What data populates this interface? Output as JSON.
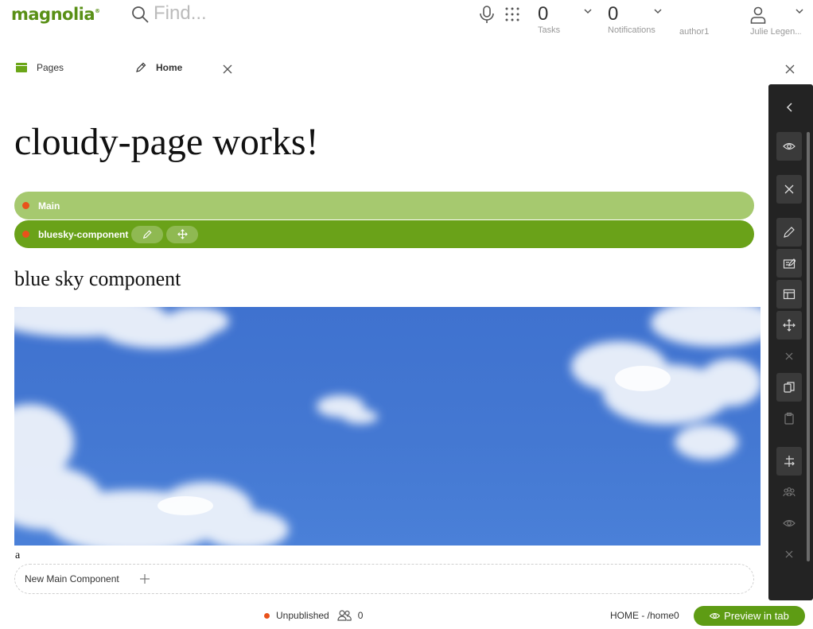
{
  "app": {
    "logo_text": "magnolia",
    "logo_mark": "®",
    "brand_color": "#599016"
  },
  "header": {
    "search_placeholder": "Find...",
    "tasks": {
      "count": "0",
      "label": "Tasks"
    },
    "notifications": {
      "count": "0",
      "label": "Notifications"
    },
    "author": "author1",
    "user": "Julie Legen..."
  },
  "tabs": [
    {
      "label": "Pages",
      "icon": "pages-icon"
    },
    {
      "label": "Home",
      "icon": "pencil-icon"
    }
  ],
  "page": {
    "title": "cloudy-page works!",
    "area_label": "Main",
    "component_label": "bluesky-component",
    "component_heading": "blue sky component",
    "image_caption": "a",
    "new_component_label": "New Main Component"
  },
  "toolbar": {
    "icons": [
      "chevron-left-icon",
      "preview-icon",
      "close-icon",
      "edit-icon",
      "edit-page-properties-icon",
      "template-icon",
      "move-icon",
      "delete-icon",
      "copy-icon",
      "paste-icon",
      "export-icon",
      "permissions-icon",
      "eye-icon",
      "close-icon"
    ]
  },
  "footer": {
    "status": "Unpublished",
    "status_color": "#e9521b",
    "users_count": "0",
    "path": "HOME - /home0",
    "preview_label": "Preview in tab"
  }
}
